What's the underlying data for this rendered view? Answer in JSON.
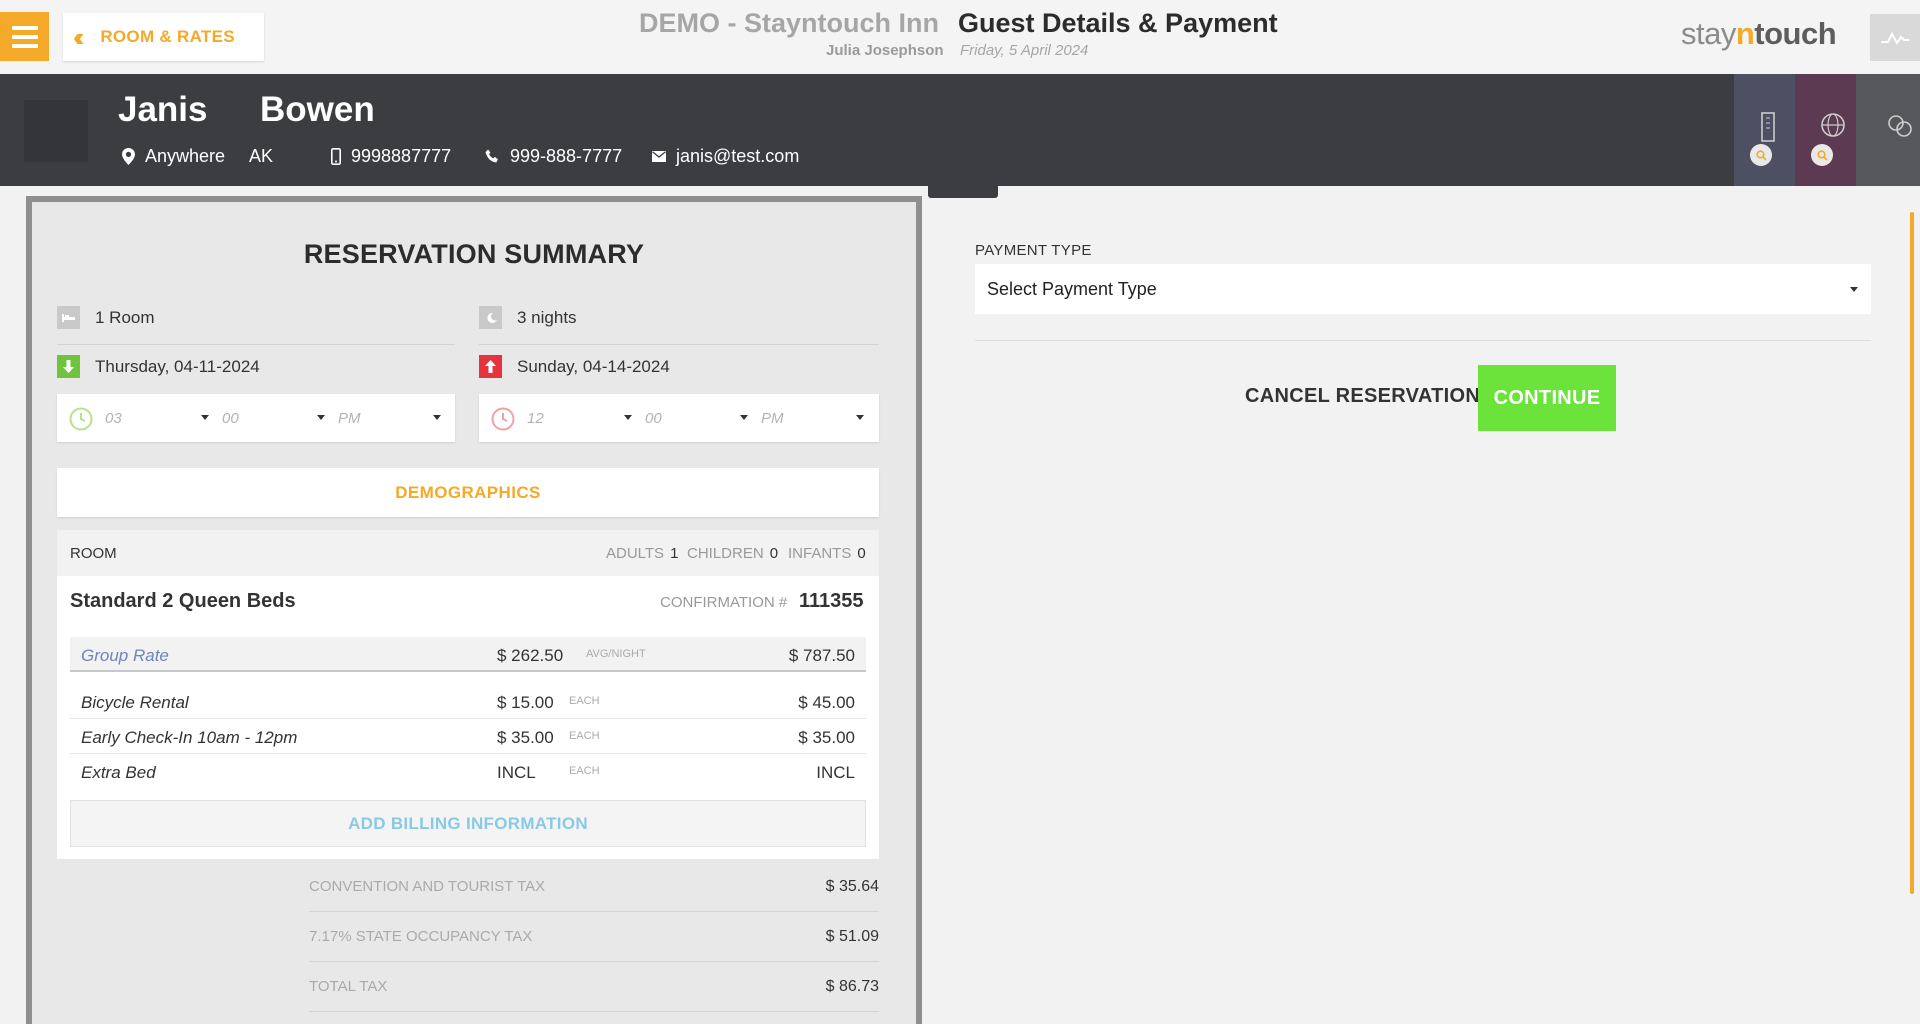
{
  "topbar": {
    "back_label": "ROOM & RATES",
    "hotel_name": "DEMO - Stayntouch Inn",
    "page_title": "Guest Details & Payment",
    "user_name": "Julia Josephson",
    "business_date": "Friday, 5 April 2024",
    "brand": {
      "stay": "stay",
      "n": "n",
      "touch": "touch"
    },
    "accent_color": "#f4a928"
  },
  "guest": {
    "first_name": "Janis",
    "last_name": "Bowen",
    "city": "Anywhere",
    "state": "AK",
    "mobile": "9998887777",
    "phone": "999-888-7777",
    "email": "janis@test.com"
  },
  "summary": {
    "title": "RESERVATION SUMMARY",
    "rooms": "1 Room",
    "nights": "3 nights",
    "arrival_date": "Thursday, 04-11-2024",
    "departure_date": "Sunday, 04-14-2024",
    "arrival_time": {
      "hour": "03",
      "minute": "00",
      "ampm": "PM"
    },
    "departure_time": {
      "hour": "12",
      "minute": "00",
      "ampm": "PM"
    },
    "demographics_label": "DEMOGRAPHICS",
    "room": {
      "header_label": "ROOM",
      "adults_label": "ADULTS",
      "adults": "1",
      "children_label": "CHILDREN",
      "children": "0",
      "infants_label": "INFANTS",
      "infants": "0",
      "type": "Standard 2 Queen Beds",
      "confirmation_label": "CONFIRMATION #",
      "confirmation_no": "111355"
    },
    "rate": {
      "name": "Group Rate",
      "amount": "$ 262.50",
      "unit": "AVG/NIGHT",
      "total": "$ 787.50"
    },
    "addons": [
      {
        "name": "Bicycle Rental",
        "amount": "$ 15.00",
        "unit": "EACH",
        "total": "$ 45.00"
      },
      {
        "name": "Early Check-In 10am - 12pm",
        "amount": "$ 35.00",
        "unit": "EACH",
        "total": "$ 35.00"
      },
      {
        "name": "Extra Bed",
        "amount": "INCL",
        "unit": "EACH",
        "total": "INCL"
      }
    ],
    "add_billing_label": "ADD BILLING INFORMATION",
    "taxes": [
      {
        "label": "CONVENTION AND TOURIST TAX",
        "value": "$ 35.64"
      },
      {
        "label": "7.17% STATE OCCUPANCY TAX",
        "value": "$ 51.09"
      },
      {
        "label": "TOTAL TAX",
        "value": "$ 86.73"
      }
    ]
  },
  "payment": {
    "label": "PAYMENT TYPE",
    "selected": "Select Payment Type",
    "cancel_label": "CANCEL RESERVATION",
    "continue_label": "CONTINUE",
    "continue_color": "#6be33b"
  },
  "icons": [
    "menu-icon",
    "double-chevron-left-icon",
    "activity-icon",
    "location-pin-icon",
    "mobile-icon",
    "phone-icon",
    "envelope-icon",
    "building-icon",
    "globe-icon",
    "search-icon",
    "clock-icon",
    "bed-icon",
    "moon-icon",
    "arrow-down-icon",
    "arrow-up-icon"
  ]
}
